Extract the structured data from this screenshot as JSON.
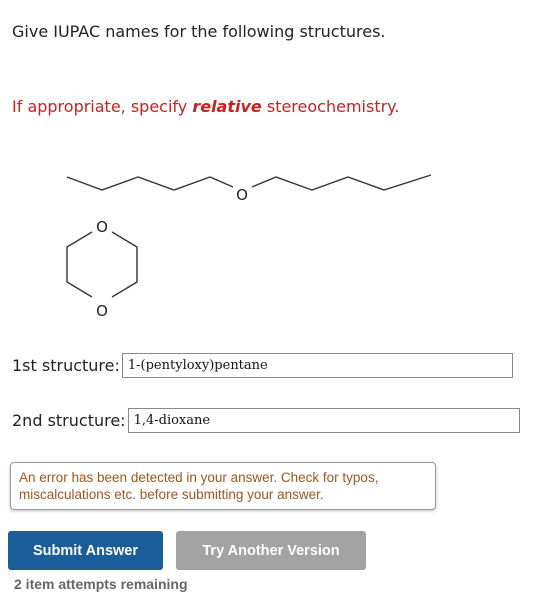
{
  "question": {
    "prompt": "Give IUPAC names for the following structures.",
    "stereo_before": "If appropriate, specify ",
    "stereo_emphasis": "relative",
    "stereo_after": " stereochemistry."
  },
  "structure1": {
    "atom": "O"
  },
  "structure2": {
    "atom_top": "O",
    "atom_bottom": "O"
  },
  "answers": [
    {
      "label": "1st structure:",
      "value": "1-(pentyloxy)pentane"
    },
    {
      "label": "2nd structure:",
      "value": "1,4-dioxane"
    }
  ],
  "feedback": {
    "message": "An error has been detected in your answer. Check for typos, miscalculations etc. before submitting your answer."
  },
  "buttons": {
    "submit": "Submit Answer",
    "another": "Try Another Version"
  },
  "attempts": "2 item attempts remaining",
  "colors": {
    "stereo_text": "#cc1f1f",
    "submit_bg": "#1b5d99",
    "another_bg": "#a3a3a3",
    "error_text": "#a0561d"
  }
}
